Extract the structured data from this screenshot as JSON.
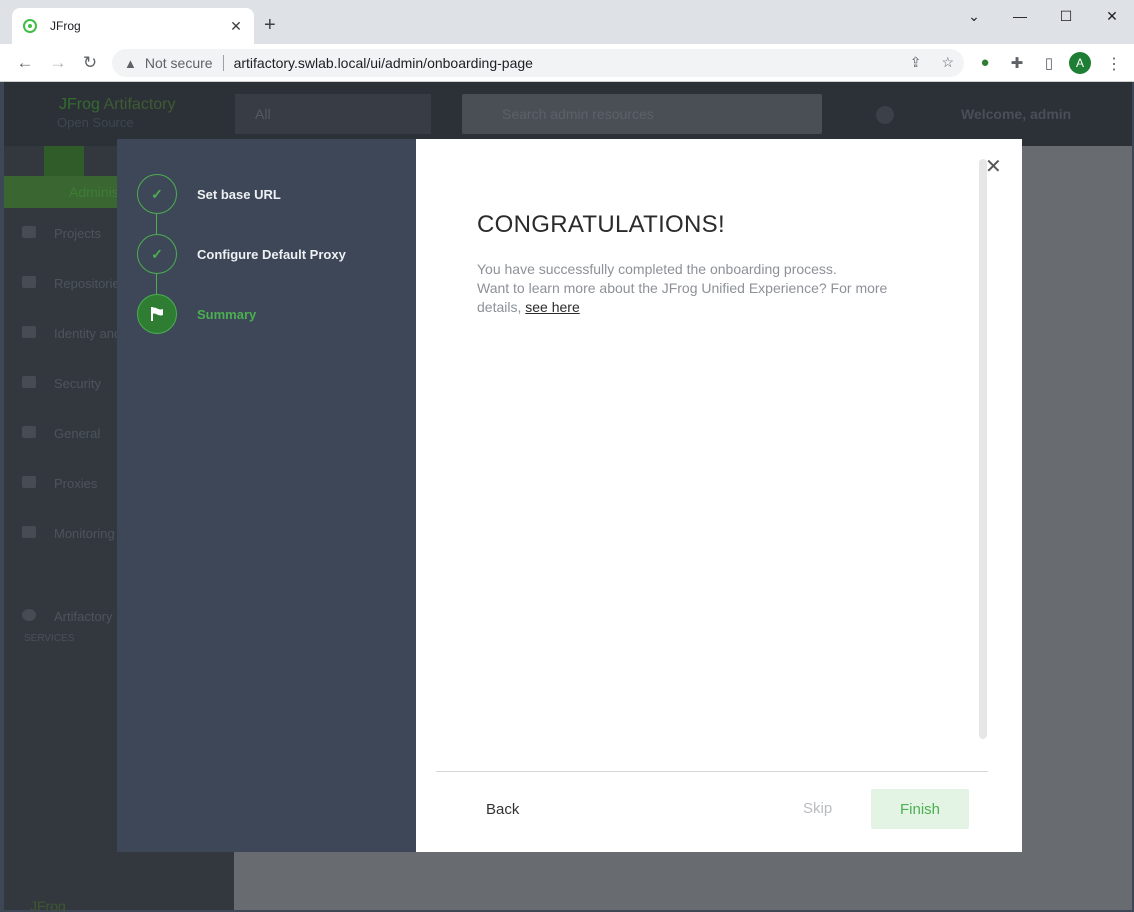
{
  "browser": {
    "tab_title": "JFrog",
    "tab_favicon": "jfrog-frog-icon",
    "not_secure": "Not secure",
    "url": "artifactory.swlab.local/ui/admin/onboarding-page",
    "profile_initial": "A"
  },
  "app": {
    "logo_line1_brand": "JFrog",
    "logo_line1_product": " Artifactory",
    "logo_line2": "Open Source",
    "repo_filter": "All",
    "search_placeholder": "Search admin resources",
    "welcome": "Welcome, admin",
    "sidebar": {
      "admin_tab": "Administration",
      "items": [
        {
          "label": "Projects"
        },
        {
          "label": "Repositories"
        },
        {
          "label": "Identity and Access"
        },
        {
          "label": "Security"
        },
        {
          "label": "General"
        },
        {
          "label": "Proxies"
        },
        {
          "label": "Monitoring"
        }
      ],
      "services_heading": "SERVICES",
      "service_item": "Artifactory",
      "footer_logo": "JFrog"
    }
  },
  "wizard": {
    "steps": [
      {
        "label": "Set base URL",
        "state": "complete"
      },
      {
        "label": "Configure Default Proxy",
        "state": "complete"
      },
      {
        "label": "Summary",
        "state": "active"
      }
    ],
    "title": "CONGRATULATIONS!",
    "line1": "You have successfully completed the onboarding process.",
    "line2": "Want to learn more about the JFrog Unified Experience? For more details, ",
    "link": "see here",
    "back_label": "Back",
    "skip_label": "Skip",
    "finish_label": "Finish",
    "accent_color": "#4caf50"
  }
}
